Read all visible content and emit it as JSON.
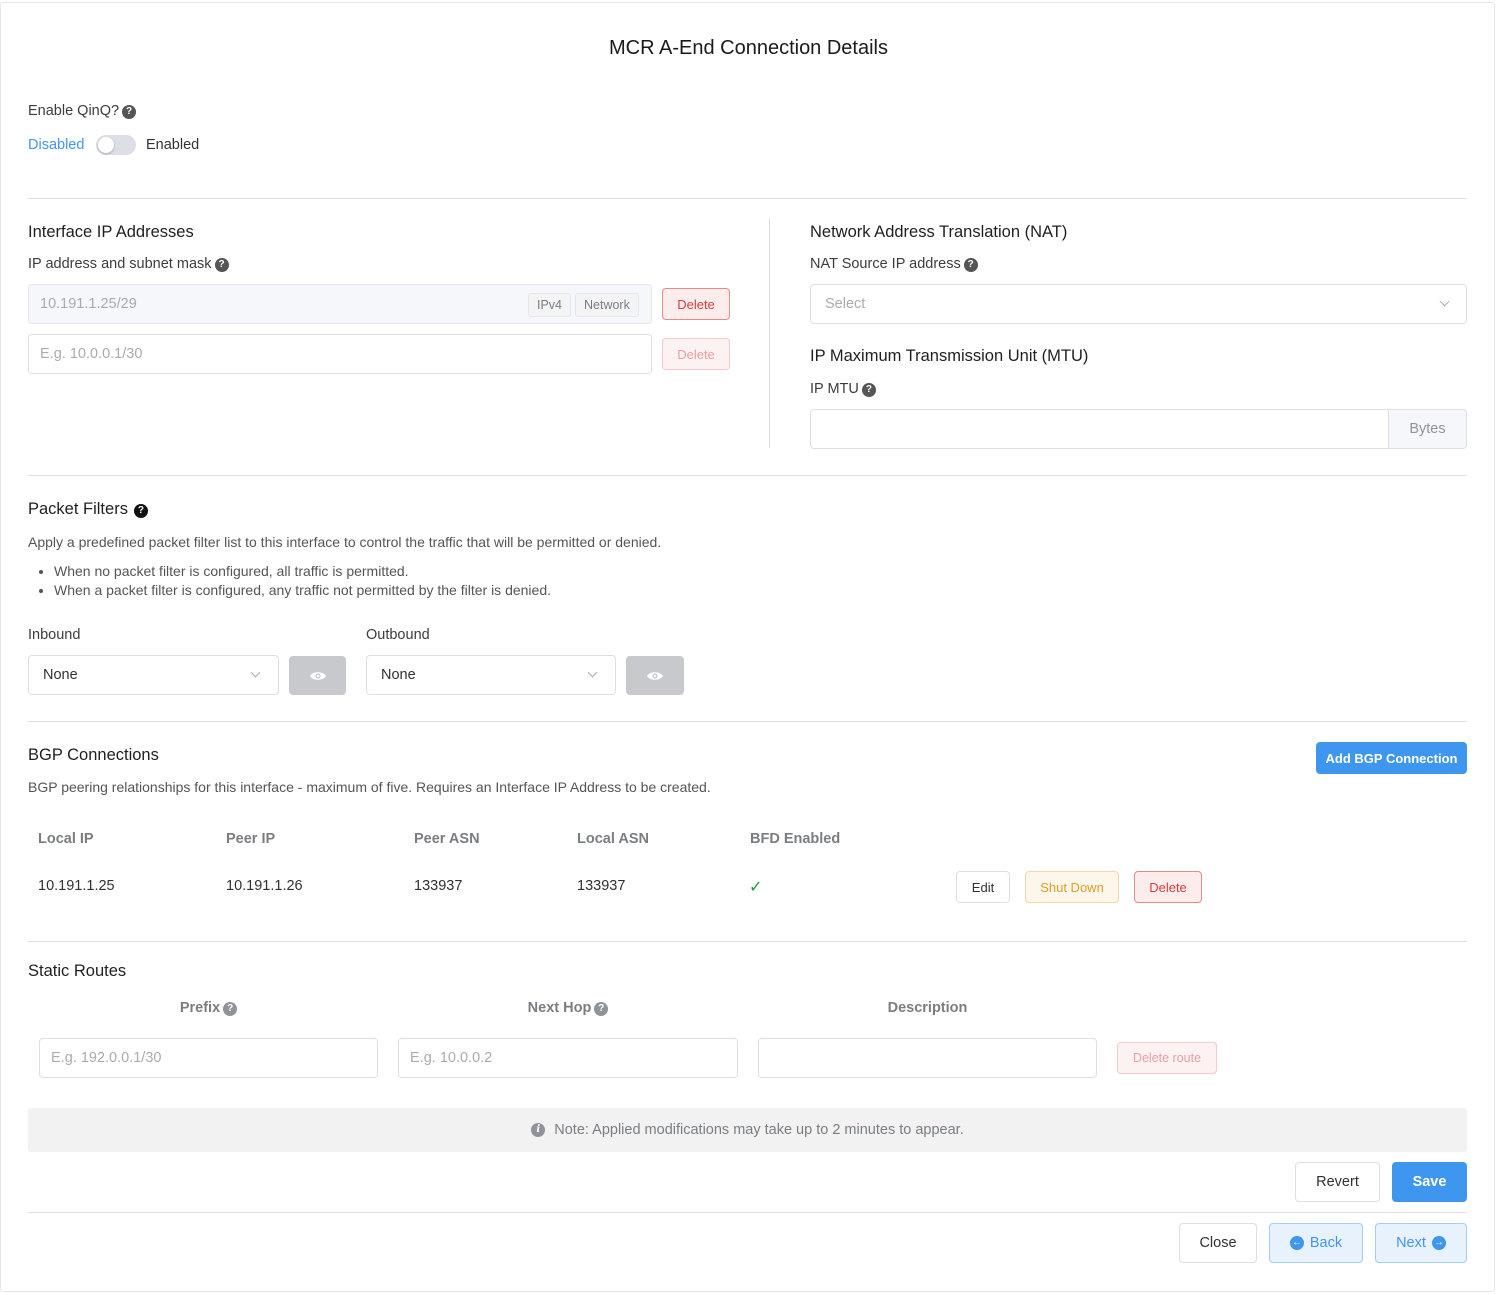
{
  "title": "MCR A-End Connection Details",
  "qinq": {
    "label": "Enable QinQ?",
    "off_label": "Disabled",
    "on_label": "Enabled"
  },
  "interface_ip": {
    "heading": "Interface IP Addresses",
    "field_label": "IP address and subnet mask",
    "rows": [
      {
        "value": "10.191.1.25/29",
        "tags": [
          "IPv4",
          "Network"
        ],
        "delete_label": "Delete"
      },
      {
        "placeholder": "E.g. 10.0.0.1/30",
        "delete_label": "Delete"
      }
    ]
  },
  "nat": {
    "heading": "Network Address Translation (NAT)",
    "field_label": "NAT Source IP address",
    "placeholder": "Select"
  },
  "mtu": {
    "heading": "IP Maximum Transmission Unit (MTU)",
    "field_label": "IP MTU",
    "unit": "Bytes"
  },
  "packet_filters": {
    "heading": "Packet Filters",
    "description": "Apply a predefined packet filter list to this interface to control the traffic that will be permitted or denied.",
    "bullets": [
      "When no packet filter is configured, all traffic is permitted.",
      "When a packet filter is configured, any traffic not permitted by the filter is denied."
    ],
    "inbound": {
      "label": "Inbound",
      "value": "None"
    },
    "outbound": {
      "label": "Outbound",
      "value": "None"
    }
  },
  "bgp": {
    "heading": "BGP Connections",
    "add_label": "Add BGP Connection",
    "description": "BGP peering relationships for this interface - maximum of five. Requires an Interface IP Address to be created.",
    "columns": [
      "Local IP",
      "Peer IP",
      "Peer ASN",
      "Local ASN",
      "BFD Enabled"
    ],
    "rows": [
      {
        "local_ip": "10.191.1.25",
        "peer_ip": "10.191.1.26",
        "peer_asn": "133937",
        "local_asn": "133937",
        "bfd": "✓"
      }
    ],
    "actions": {
      "edit": "Edit",
      "shutdown": "Shut Down",
      "delete": "Delete"
    }
  },
  "static_routes": {
    "heading": "Static Routes",
    "columns": {
      "prefix": "Prefix",
      "next_hop": "Next Hop",
      "description": "Description"
    },
    "row": {
      "prefix_placeholder": "E.g. 192.0.0.1/30",
      "next_hop_placeholder": "E.g. 10.0.0.2",
      "description_placeholder": "",
      "delete_label": "Delete route"
    }
  },
  "note": "Note: Applied modifications may take up to 2 minutes to appear.",
  "footer": {
    "revert": "Revert",
    "save": "Save",
    "close": "Close",
    "back": "Back",
    "next": "Next"
  },
  "colors": {
    "primary": "#3f96ee",
    "danger": "#d43d3d",
    "warning": "#e29d25",
    "success": "#1a9a3a"
  }
}
